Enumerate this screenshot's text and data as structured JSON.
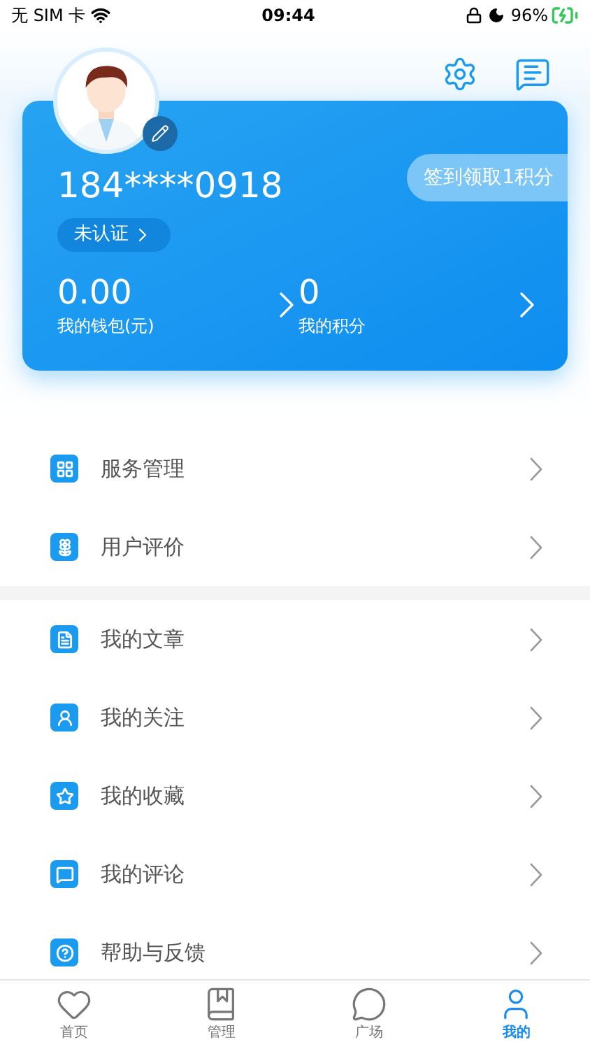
{
  "status_bar": {
    "carrier": "无 SIM 卡",
    "time": "09:44",
    "battery": "96%"
  },
  "profile": {
    "phone": "184****0918",
    "verify": "未认证",
    "checkin": "签到领取1积分"
  },
  "stats": [
    {
      "value": "0.00",
      "label": "我的钱包(元)"
    },
    {
      "value": "0",
      "label": "我的积分"
    }
  ],
  "menu_sections": [
    [
      {
        "label": "服务管理",
        "kind": "grid"
      },
      {
        "label": "用户评价",
        "kind": "flower"
      }
    ],
    [
      {
        "label": "我的文章",
        "kind": "doc"
      },
      {
        "label": "我的关注",
        "kind": "user"
      },
      {
        "label": "我的收藏",
        "kind": "star"
      },
      {
        "label": "我的评论",
        "kind": "comment"
      },
      {
        "label": "帮助与反馈",
        "kind": "help"
      }
    ]
  ],
  "tabs": [
    {
      "label": "首页",
      "kind": "heart",
      "selected": false
    },
    {
      "label": "管理",
      "kind": "book",
      "selected": false
    },
    {
      "label": "广场",
      "kind": "chat",
      "selected": false
    },
    {
      "label": "我的",
      "kind": "person",
      "selected": true
    }
  ]
}
